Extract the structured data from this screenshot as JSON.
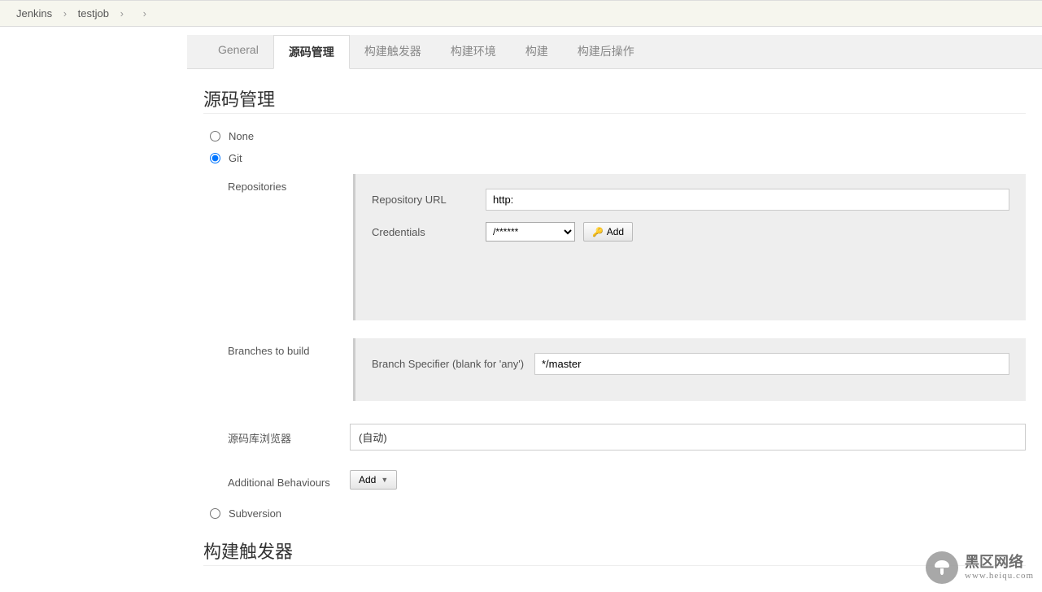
{
  "breadcrumb": {
    "root": "Jenkins",
    "job": "testjob"
  },
  "tabs": {
    "general": "General",
    "scm": "源码管理",
    "triggers": "构建触发器",
    "env": "构建环境",
    "build": "构建",
    "post": "构建后操作"
  },
  "section": {
    "scm_title": "源码管理",
    "triggers_title": "构建触发器"
  },
  "scm": {
    "none": "None",
    "git": "Git",
    "subversion": "Subversion",
    "repositories": "Repositories",
    "repo_url_label": "Repository URL",
    "repo_url_value": "http:",
    "credentials_label": "Credentials",
    "credentials_value": "/******",
    "add_btn": "Add",
    "branches_label": "Branches to build",
    "branch_spec_label": "Branch Specifier (blank for 'any')",
    "branch_spec_value": "*/master",
    "browser_label": "源码库浏览器",
    "browser_value": "(自动)",
    "additional_label": "Additional Behaviours",
    "additional_add": "Add"
  },
  "watermark": {
    "name": "黑区网络",
    "url": "www.heiqu.com"
  }
}
